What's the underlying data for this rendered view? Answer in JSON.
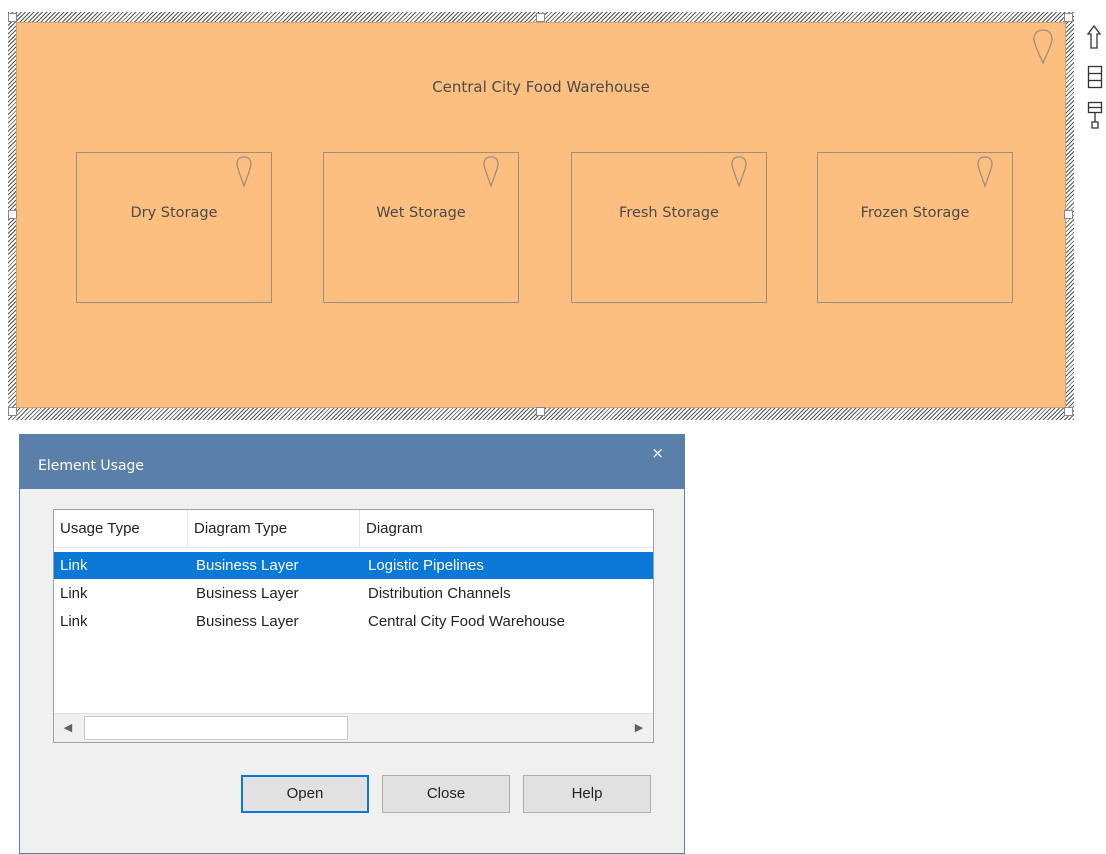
{
  "diagram": {
    "title": "Central City Food Warehouse",
    "sub_locations": [
      {
        "label": "Dry Storage"
      },
      {
        "label": "Wet Storage"
      },
      {
        "label": "Fresh Storage"
      },
      {
        "label": "Frozen Storage"
      }
    ],
    "fill_color": "#fdbf80"
  },
  "dialog": {
    "title": "Element Usage",
    "close_glyph": "×",
    "columns": [
      "Usage Type",
      "Diagram Type",
      "Diagram"
    ],
    "rows": [
      {
        "usage_type": "Link",
        "diagram_type": "Business Layer",
        "diagram": "Logistic Pipelines",
        "selected": true
      },
      {
        "usage_type": "Link",
        "diagram_type": "Business Layer",
        "diagram": "Distribution Channels",
        "selected": false
      },
      {
        "usage_type": "Link",
        "diagram_type": "Business Layer",
        "diagram": "Central City Food Warehouse",
        "selected": false
      }
    ],
    "buttons": {
      "open": "Open",
      "close": "Close",
      "help": "Help"
    },
    "accent_color": "#0a78d7",
    "titlebar_color": "#5a7fa8"
  },
  "icons": {
    "location": "location-pin-icon",
    "side_toolbar": [
      "arrow-up-icon",
      "list-icon",
      "format-painter-icon"
    ],
    "scroll_left": "◀",
    "scroll_right": "▶"
  }
}
